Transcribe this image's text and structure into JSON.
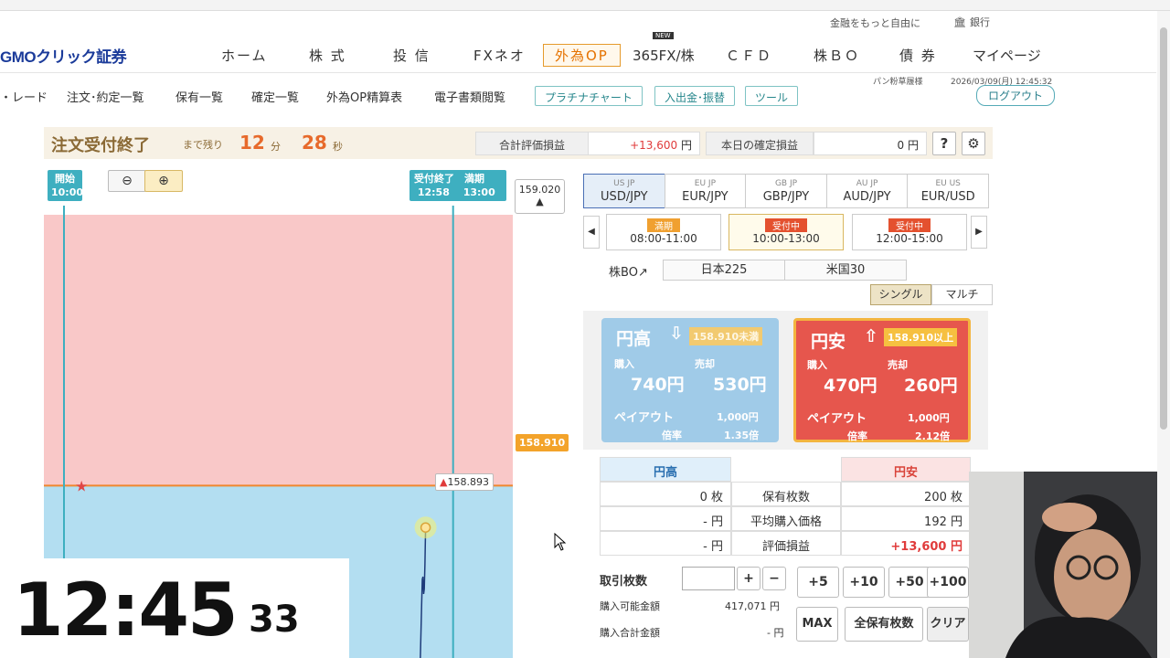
{
  "utility": {
    "tagline": "金融をもっと自由に",
    "bank": "銀行"
  },
  "logo": "GMOクリック証券",
  "nav": {
    "home": "ホーム",
    "stocks": "株 式",
    "funds": "投 信",
    "fxneo": "FXネオ",
    "fxop": "外為OP",
    "fx365": "365FX/株",
    "cfd": "ＣＦＤ",
    "stockbo": "株ＢＯ",
    "bonds": "債 券",
    "mypage": "マイページ",
    "new_badge": "NEW"
  },
  "subnav": {
    "trade": "・レード",
    "orders": "注文･約定一覧",
    "holdings": "保有一覧",
    "settled": "確定一覧",
    "fxop_settle": "外為OP精算表",
    "edocs": "電子書類閲覧",
    "platinum": "プラチナチャート",
    "deposit": "入出金･振替",
    "tools": "ツール",
    "user": "パン粉草履様",
    "datetime": "2026/03/09(月) 12:45:32",
    "logout": "ログアウト"
  },
  "status": {
    "title": "注文受付終了",
    "remain_label": "まで残り",
    "min": "12",
    "min_unit": "分",
    "sec": "28",
    "sec_unit": "秒",
    "pl_label": "合計評価損益",
    "pl_value": "+13,600",
    "yen": "円",
    "today_label": "本日の確定損益",
    "today_value": "0"
  },
  "chart_data": {
    "type": "line",
    "title": "",
    "markers": {
      "start_label": "開始",
      "start_time": "10:00",
      "end_label": "受付終了",
      "end_time": "12:58",
      "expiry_label": "満期",
      "expiry_time": "13:00"
    },
    "top_price": "159.020",
    "strike": "158.910",
    "current": "158.893",
    "ylim": [
      158.84,
      159.02
    ],
    "series": [
      {
        "values": [
          [
            12.72,
            158.84
          ],
          [
            12.73,
            158.862
          ],
          [
            12.735,
            158.872
          ],
          [
            12.74,
            158.873
          ],
          [
            12.745,
            158.866
          ],
          [
            12.75,
            158.868
          ],
          [
            12.755,
            158.878
          ],
          [
            12.76,
            158.893
          ]
        ]
      }
    ],
    "colors": {
      "above": "#f9c8c8",
      "below": "#b3def1",
      "line": "#1e3b7a",
      "strike": "#f0862e"
    }
  },
  "clock": {
    "hm": "12:45",
    "sec": "33"
  },
  "pairs": [
    {
      "label": "USD/JPY",
      "flags": "US JP"
    },
    {
      "label": "EUR/JPY",
      "flags": "EU JP"
    },
    {
      "label": "GBP/JPY",
      "flags": "GB JP"
    },
    {
      "label": "AUD/JPY",
      "flags": "AU JP"
    },
    {
      "label": "EUR/USD",
      "flags": "EU US"
    }
  ],
  "slots": [
    {
      "status": "満期",
      "time": "08:00-11:00"
    },
    {
      "status": "受付中",
      "time": "10:00-13:00"
    },
    {
      "status": "受付中",
      "time": "12:00-15:00"
    }
  ],
  "stockbo": {
    "label": "株BO",
    "nikkei": "日本225",
    "us30": "米国30"
  },
  "modes": {
    "single": "シングル",
    "multi": "マルチ"
  },
  "up_card": {
    "title": "円高",
    "cond": "158.910未満",
    "buy_label": "購入",
    "sell_label": "売却",
    "buy": "740円",
    "sell": "530円",
    "payout_label": "ペイアウト",
    "payout": "1,000円",
    "rate_label": "倍率",
    "rate": "1.35倍"
  },
  "down_card": {
    "title": "円安",
    "cond": "158.910以上",
    "buy_label": "購入",
    "sell_label": "売却",
    "buy": "470円",
    "sell": "260円",
    "payout_label": "ペイアウト",
    "payout": "1,000円",
    "rate_label": "倍率",
    "rate": "2.12倍"
  },
  "positions": {
    "col_up": "円高",
    "col_down": "円安",
    "rows": [
      {
        "label": "保有枚数",
        "up": "0 枚",
        "down": "200 枚"
      },
      {
        "label": "平均購入価格",
        "up": "- 円",
        "down": "192 円"
      },
      {
        "label": "評価損益",
        "up": "- 円",
        "down": "+13,600 円"
      }
    ]
  },
  "qty": {
    "label": "取引枚数",
    "plus": "+",
    "minus": "−",
    "p5": "+5",
    "p10": "+10",
    "p50": "+50",
    "p100": "+100",
    "avail_label": "購入可能金額",
    "avail": "417,071 円",
    "total_label": "購入合計金額",
    "total": "- 円",
    "max": "MAX",
    "all": "全保有枚数",
    "clear": "クリア"
  }
}
